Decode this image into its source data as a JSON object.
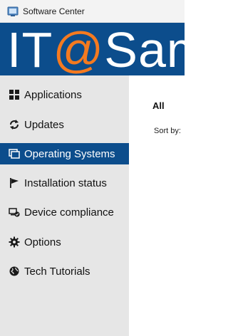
{
  "window": {
    "title": "Software Center"
  },
  "banner": {
    "part1": "IT",
    "part2": "@",
    "part3": "Sam"
  },
  "sidebar": {
    "items": [
      {
        "label": "Applications",
        "icon": "grid-icon"
      },
      {
        "label": "Updates",
        "icon": "refresh-icon"
      },
      {
        "label": "Operating Systems",
        "icon": "windows-stack-icon",
        "selected": true
      },
      {
        "label": "Installation status",
        "icon": "flag-icon"
      },
      {
        "label": "Device compliance",
        "icon": "device-check-icon"
      },
      {
        "label": "Options",
        "icon": "gear-icon"
      },
      {
        "label": "Tech Tutorials",
        "icon": "globe-icon"
      }
    ]
  },
  "content": {
    "filter_title": "All",
    "sort_label": "Sort by:"
  },
  "colors": {
    "brand_blue": "#0c4d8c",
    "accent_orange": "#f47a20",
    "sidebar_bg": "#e6e6e6"
  }
}
